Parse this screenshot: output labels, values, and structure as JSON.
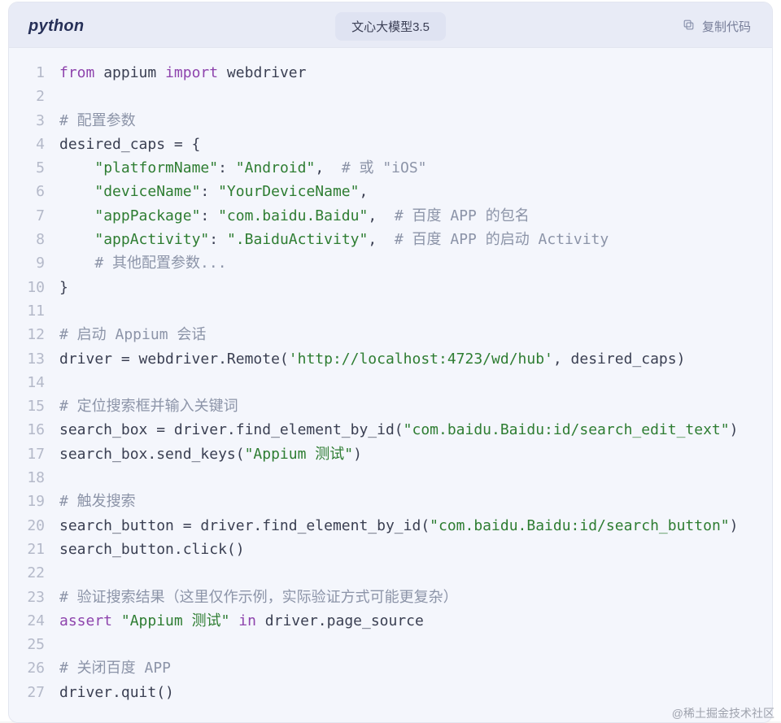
{
  "header": {
    "language": "python",
    "model_chip": "文心大模型3.5",
    "copy_label": "复制代码"
  },
  "watermark": "@稀土掘金技术社区",
  "code": {
    "lines": [
      [
        {
          "c": "kw",
          "t": "from"
        },
        {
          "c": "nm",
          "t": " appium "
        },
        {
          "c": "kw",
          "t": "import"
        },
        {
          "c": "nm",
          "t": " webdriver"
        }
      ],
      [],
      [
        {
          "c": "cm",
          "t": "# 配置参数"
        }
      ],
      [
        {
          "c": "nm",
          "t": "desired_caps = {"
        }
      ],
      [
        {
          "c": "nm",
          "t": "    "
        },
        {
          "c": "str",
          "t": "\"platformName\""
        },
        {
          "c": "nm",
          "t": ": "
        },
        {
          "c": "str",
          "t": "\"Android\""
        },
        {
          "c": "nm",
          "t": ",  "
        },
        {
          "c": "cm",
          "t": "# 或 \"iOS\""
        }
      ],
      [
        {
          "c": "nm",
          "t": "    "
        },
        {
          "c": "str",
          "t": "\"deviceName\""
        },
        {
          "c": "nm",
          "t": ": "
        },
        {
          "c": "str",
          "t": "\"YourDeviceName\""
        },
        {
          "c": "nm",
          "t": ","
        }
      ],
      [
        {
          "c": "nm",
          "t": "    "
        },
        {
          "c": "str",
          "t": "\"appPackage\""
        },
        {
          "c": "nm",
          "t": ": "
        },
        {
          "c": "str",
          "t": "\"com.baidu.Baidu\""
        },
        {
          "c": "nm",
          "t": ",  "
        },
        {
          "c": "cm",
          "t": "# 百度 APP 的包名"
        }
      ],
      [
        {
          "c": "nm",
          "t": "    "
        },
        {
          "c": "str",
          "t": "\"appActivity\""
        },
        {
          "c": "nm",
          "t": ": "
        },
        {
          "c": "str",
          "t": "\".BaiduActivity\""
        },
        {
          "c": "nm",
          "t": ",  "
        },
        {
          "c": "cm",
          "t": "# 百度 APP 的启动 Activity"
        }
      ],
      [
        {
          "c": "nm",
          "t": "    "
        },
        {
          "c": "cm",
          "t": "# 其他配置参数..."
        }
      ],
      [
        {
          "c": "nm",
          "t": "}"
        }
      ],
      [],
      [
        {
          "c": "cm",
          "t": "# 启动 Appium 会话"
        }
      ],
      [
        {
          "c": "nm",
          "t": "driver = webdriver.Remote("
        },
        {
          "c": "str",
          "t": "'http://localhost:4723/wd/hub'"
        },
        {
          "c": "nm",
          "t": ", desired_caps)"
        }
      ],
      [],
      [
        {
          "c": "cm",
          "t": "# 定位搜索框并输入关键词"
        }
      ],
      [
        {
          "c": "nm",
          "t": "search_box = driver.find_element_by_id("
        },
        {
          "c": "str",
          "t": "\"com.baidu.Baidu:id/search_edit_text\""
        },
        {
          "c": "nm",
          "t": ")"
        }
      ],
      [
        {
          "c": "nm",
          "t": "search_box.send_keys("
        },
        {
          "c": "str",
          "t": "\"Appium 测试\""
        },
        {
          "c": "nm",
          "t": ")"
        }
      ],
      [],
      [
        {
          "c": "cm",
          "t": "# 触发搜索"
        }
      ],
      [
        {
          "c": "nm",
          "t": "search_button = driver.find_element_by_id("
        },
        {
          "c": "str",
          "t": "\"com.baidu.Baidu:id/search_button\""
        },
        {
          "c": "nm",
          "t": ")"
        }
      ],
      [
        {
          "c": "nm",
          "t": "search_button.click()"
        }
      ],
      [],
      [
        {
          "c": "cm",
          "t": "# 验证搜索结果（这里仅作示例，实际验证方式可能更复杂）"
        }
      ],
      [
        {
          "c": "kw",
          "t": "assert"
        },
        {
          "c": "nm",
          "t": " "
        },
        {
          "c": "str",
          "t": "\"Appium 测试\""
        },
        {
          "c": "nm",
          "t": " "
        },
        {
          "c": "kw",
          "t": "in"
        },
        {
          "c": "nm",
          "t": " driver.page_source"
        }
      ],
      [],
      [
        {
          "c": "cm",
          "t": "# 关闭百度 APP"
        }
      ],
      [
        {
          "c": "nm",
          "t": "driver.quit()"
        }
      ]
    ]
  }
}
